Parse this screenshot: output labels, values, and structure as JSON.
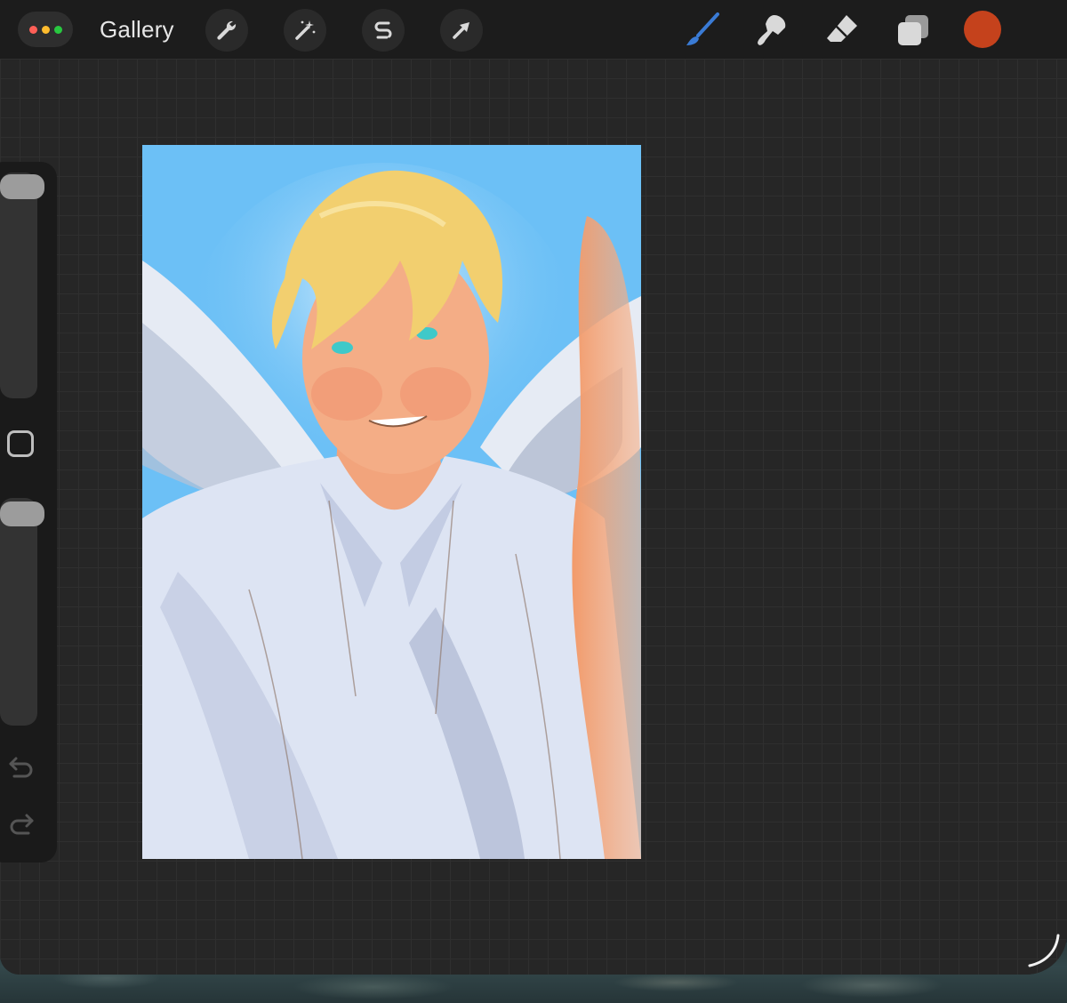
{
  "toolbar": {
    "gallery_label": "Gallery",
    "window_dots": [
      "#ff5f57",
      "#febc2e",
      "#28c840"
    ],
    "left_tools": [
      "wrench-icon",
      "magic-wand-icon",
      "selection-s-icon",
      "arrow-transform-icon"
    ],
    "right_tools": [
      "brush-icon",
      "smudge-icon",
      "eraser-icon",
      "layers-icon"
    ],
    "active_tool": "brush-icon",
    "current_color": "#c5421c"
  },
  "sidebar": {
    "size_slider": 1.0,
    "opacity_slider": 1.0,
    "modify_button": "square-icon",
    "undo": "undo-icon",
    "redo": "redo-icon"
  },
  "colors": {
    "sky": "#6cc0f6",
    "hair": "#f2cf6f",
    "skin": "#f2a47c",
    "shirt": "#c9d2ea",
    "wings": "#e4e9f3",
    "accent_blue": "#3a7bd5"
  }
}
